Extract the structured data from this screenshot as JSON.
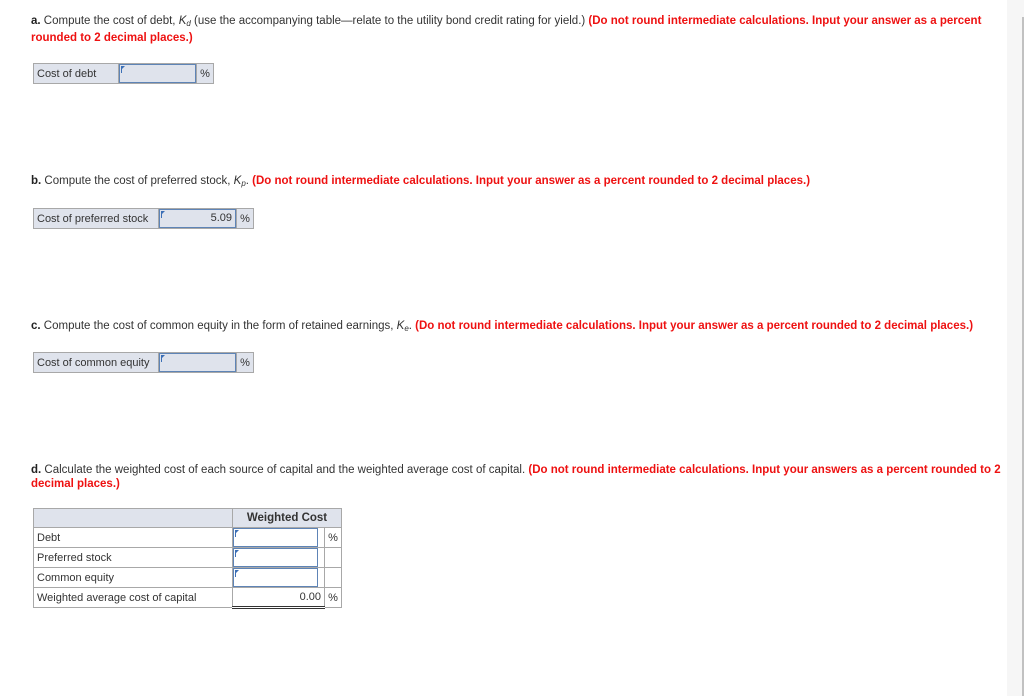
{
  "questions": {
    "a": {
      "letter": "a.",
      "text_before_var": " Compute the cost of debt, ",
      "var_main": "K",
      "var_sub": "d",
      "text_after_var": " (use the accompanying table—relate to the utility bond credit rating for yield.) ",
      "warning": "(Do not round intermediate calculations. Input your answer as a percent rounded to 2 decimal places.)",
      "field_label": "Cost of debt",
      "field_value": "",
      "unit": "%"
    },
    "b": {
      "letter": "b.",
      "text_before_var": " Compute the cost of preferred stock, ",
      "var_main": "K",
      "var_sub": "p",
      "text_after_var": ". ",
      "warning": "(Do not round intermediate calculations. Input your answer as a percent rounded to 2 decimal places.)",
      "field_label": "Cost of preferred stock",
      "field_value": "5.09",
      "unit": "%"
    },
    "c": {
      "letter": "c.",
      "text_before_var": " Compute the cost of common equity in the form of retained earnings, ",
      "var_main": "K",
      "var_sub": "e",
      "text_after_var": ". ",
      "warning": "(Do not round intermediate calculations. Input your answer as a percent rounded to 2 decimal places.)",
      "field_label": "Cost of common equity",
      "field_value": "",
      "unit": "%"
    },
    "d": {
      "letter": "d.",
      "text": " Calculate the weighted cost of each source of capital and the weighted average cost of capital. ",
      "warning": "(Do not round intermediate calculations. Input your answers as a percent rounded to 2 decimal places.)",
      "table": {
        "header": "Weighted Cost",
        "rows": [
          {
            "label": "Debt",
            "value": "",
            "unit": "%"
          },
          {
            "label": "Preferred stock",
            "value": "",
            "unit": ""
          },
          {
            "label": "Common equity",
            "value": "",
            "unit": ""
          }
        ],
        "total": {
          "label": "Weighted average cost of capital",
          "value": "0.00",
          "unit": "%"
        }
      }
    }
  },
  "colors": {
    "warning": "#ee1111",
    "input_border": "#5e84b6",
    "cell_bg": "#dfe3ec"
  }
}
